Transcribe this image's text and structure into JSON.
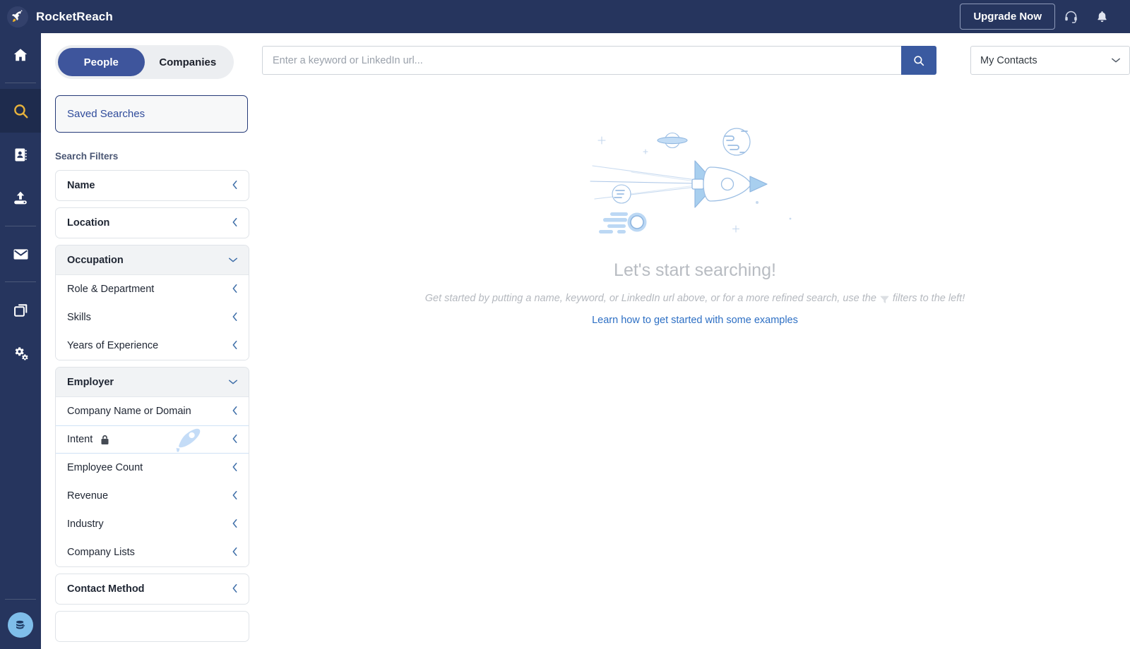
{
  "header": {
    "brand": "RocketReach",
    "logo_icon": "rocket-icon",
    "upgrade_label": "Upgrade Now",
    "support_icon": "headset-icon",
    "notifications_icon": "bell-icon"
  },
  "rail": {
    "items": [
      {
        "name": "home",
        "icon": "home-icon",
        "active": false
      },
      {
        "name": "search",
        "icon": "search-icon",
        "active": true
      },
      {
        "name": "contacts",
        "icon": "address-book-icon",
        "active": false
      },
      {
        "name": "upload",
        "icon": "upload-icon",
        "active": false
      },
      {
        "name": "messages",
        "icon": "envelope-icon",
        "active": false
      },
      {
        "name": "lists",
        "icon": "layers-icon",
        "active": false
      },
      {
        "name": "settings",
        "icon": "gears-icon",
        "active": false
      }
    ],
    "bottom_badge_icon": "database-icon",
    "badge_color": "#7fbeea"
  },
  "sidebar": {
    "toggle": {
      "people_label": "People",
      "companies_label": "Companies",
      "active": "People"
    },
    "saved_searches_label": "Saved Searches",
    "filters_title": "Search Filters",
    "groups": [
      {
        "label": "Name",
        "expanded": false,
        "chevron": "chevron-left-icon",
        "rows": []
      },
      {
        "label": "Location",
        "expanded": false,
        "chevron": "chevron-left-icon",
        "rows": []
      },
      {
        "label": "Occupation",
        "expanded": true,
        "chevron": "chevron-down-icon",
        "rows": [
          {
            "label": "Role & Department",
            "locked": false
          },
          {
            "label": "Skills",
            "locked": false
          },
          {
            "label": "Years of Experience",
            "locked": false
          }
        ]
      },
      {
        "label": "Employer",
        "expanded": true,
        "chevron": "chevron-down-icon",
        "rows": [
          {
            "label": "Company Name or Domain",
            "locked": false
          },
          {
            "label": "Intent",
            "locked": true,
            "lock_icon": "lock-icon",
            "watermark": "rocket-icon"
          },
          {
            "label": "Employee Count",
            "locked": false
          },
          {
            "label": "Revenue",
            "locked": false
          },
          {
            "label": "Industry",
            "locked": false
          },
          {
            "label": "Company Lists",
            "locked": false
          }
        ]
      },
      {
        "label": "Contact Method",
        "expanded": false,
        "chevron": "chevron-left-icon",
        "rows": []
      }
    ]
  },
  "search": {
    "placeholder": "Enter a keyword or LinkedIn url...",
    "value": "",
    "submit_icon": "search-icon",
    "submit_color": "#3a5aa0",
    "scope_selected": "My Contacts",
    "scope_chevron": "chevron-down-icon"
  },
  "empty_state": {
    "illustration": "rocket-space-illustration",
    "title": "Let's start searching!",
    "subtitle_before": "Get started by putting a name, keyword, or LinkedIn url above, or for a more refined search, use the",
    "subtitle_icon": "funnel-icon",
    "subtitle_after": "filters to the left!",
    "link_label": "Learn how to get started with some examples",
    "link_color": "#2d6fc4"
  },
  "theme": {
    "navy": "#26355e",
    "navy_active": "#1e2b4d",
    "gold": "#e8b33c",
    "accent_blue": "#3a5aa0",
    "illustration_blue": "#a8cdf0"
  }
}
